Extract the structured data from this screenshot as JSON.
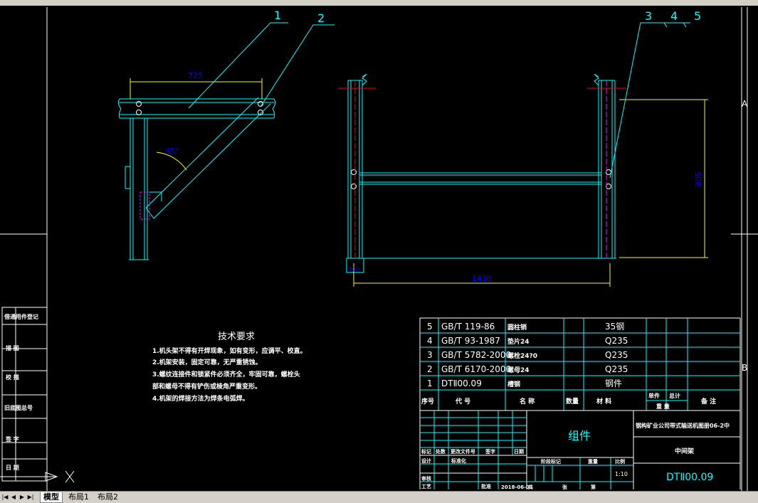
{
  "balloons": [
    "1",
    "2",
    "3",
    "4",
    "5"
  ],
  "dimensions": {
    "top_width": "725",
    "angle": "45°",
    "side_height": "805",
    "bottom_width": "1430",
    "small": "100"
  },
  "zone_letters": {
    "a": "A",
    "b": "B"
  },
  "tech": {
    "title": "技术要求",
    "lines": [
      "1.机头架不得有开焊现象，如有变形，应调平、校直。",
      "2.机架安装，固定可靠，无严重锈蚀。",
      "3.螺纹连接件和锁紧件必须齐全，牢固可靠，螺栓头",
      "   部和螺母不得有铲伤或棱角严重变形。",
      "4.机架的焊接方法为焊条电弧焊。"
    ]
  },
  "bom": {
    "rows": [
      {
        "no": "5",
        "code": "GB/T 119-86",
        "name": "圆柱销",
        "material": "35钢"
      },
      {
        "no": "4",
        "code": "GB/T 93-1987",
        "name": "垫片24",
        "material": "Q235"
      },
      {
        "no": "3",
        "code": "GB/T 5782-2000",
        "name": "螺栓24?0",
        "material": "Q235"
      },
      {
        "no": "2",
        "code": "GB/T 6170-2000",
        "name": "螺母24",
        "material": "Q235"
      },
      {
        "no": "1",
        "code": "DTⅡ00.09",
        "name": "槽钢",
        "material": "钢件"
      }
    ],
    "headers": {
      "no": "序号",
      "code": "代    号",
      "name": "名    称",
      "qty": "数量",
      "material": "材    料",
      "unit": "单件",
      "total": "总计",
      "weight": "重    量",
      "remark": "备    注"
    }
  },
  "title_block": {
    "drawing_name": "组件",
    "company": "钢构矿业公司带式输送机图册06-2中",
    "group": "中间架",
    "code": "DTⅡ00.09",
    "scale": "1:10",
    "date": "2018-06-01",
    "cells": {
      "mark": "标记",
      "count": "处数",
      "zone": "更改文件号",
      "sign": "签字",
      "datelbl": "日期",
      "design": "设计",
      "std": "标准化",
      "check": "审核",
      "craft": "工艺",
      "approve": "批准",
      "stage": "阶段标记",
      "weight": "重量",
      "scalelbl": "比例",
      "sheet": "共",
      "of": "张",
      "page": "第"
    }
  },
  "left_strip": [
    "借通用件登记",
    "描    图",
    "校    描",
    "旧底图总号",
    "签    字",
    "日    期"
  ],
  "tabs": {
    "model": "模型",
    "layout1": "布局1",
    "layout2": "布局2"
  },
  "colors": {
    "frame": "#00ffff",
    "dim": "#ffff00",
    "white": "#ffffff",
    "red": "#ff0000",
    "magenta": "#ff00ff",
    "blue": "#4040ff"
  }
}
